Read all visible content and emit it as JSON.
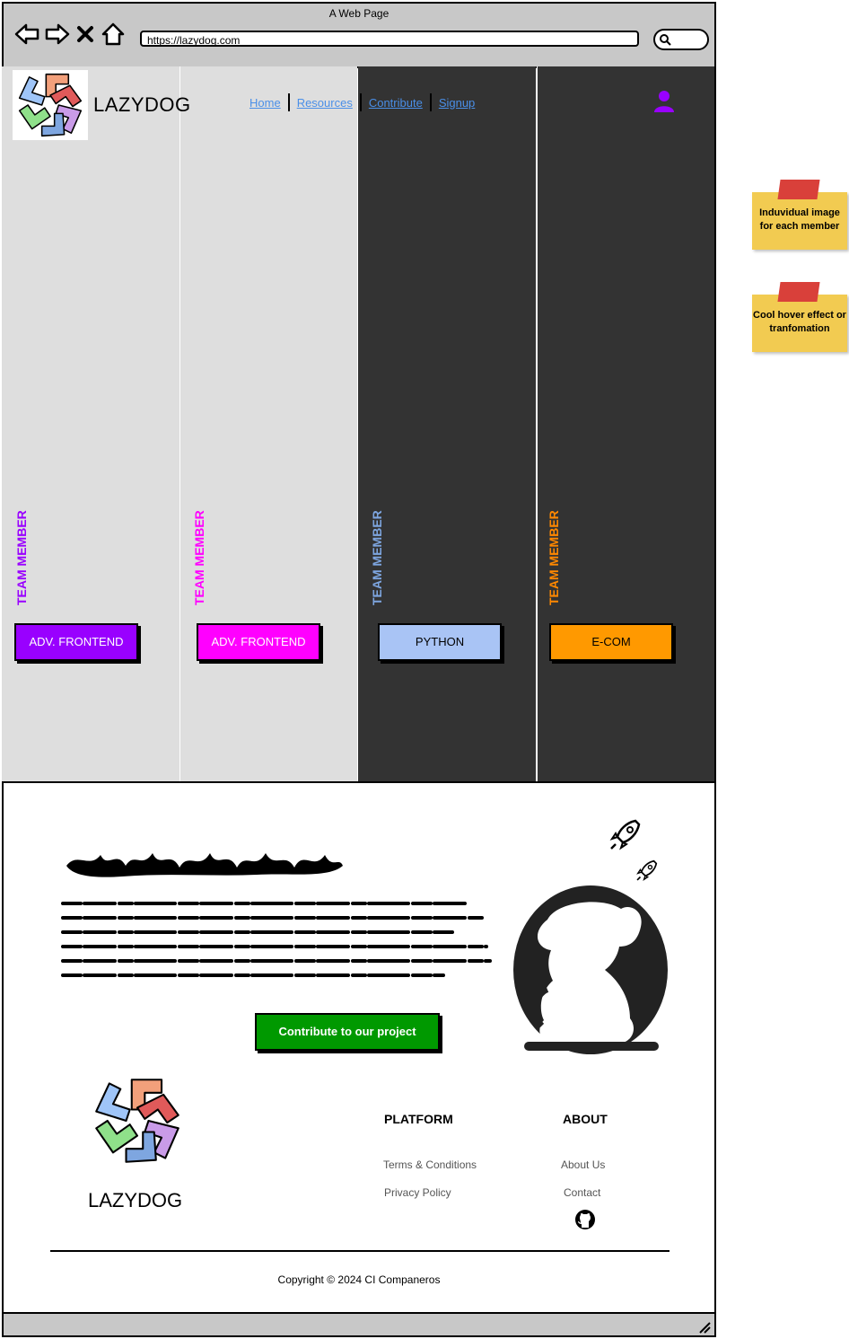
{
  "browser": {
    "window_title": "A Web Page",
    "url": "https://lazydog.com"
  },
  "header": {
    "brand": "LAZYDOG",
    "nav": [
      "Home",
      "Resources",
      "Contribute",
      "Signup"
    ]
  },
  "team": [
    {
      "label": "TEAM MEMBER",
      "label_color": "#9900ff",
      "role": "ADV. FRONTEND",
      "role_bg": "#9900ff",
      "role_fg": "#ffffff"
    },
    {
      "label": "TEAM MEMBER",
      "label_color": "#ff00ff",
      "role": "ADV. FRONTEND",
      "role_bg": "#ff00ff",
      "role_fg": "#ffffff"
    },
    {
      "label": "TEAM MEMBER",
      "label_color": "#7ea6e0",
      "role": "PYTHON",
      "role_bg": "#a9c4f5",
      "role_fg": "#000000"
    },
    {
      "label": "TEAM MEMBER",
      "label_color": "#ff8800",
      "role": "E-COM",
      "role_bg": "#ff9900",
      "role_fg": "#000000"
    }
  ],
  "hero": {
    "cta": "Contribute to our project"
  },
  "footer": {
    "brand": "LAZYDOG",
    "platform": {
      "heading": "PLATFORM",
      "links": [
        "Terms & Conditions",
        "Privacy Policy"
      ]
    },
    "about": {
      "heading": "ABOUT",
      "links": [
        "About Us",
        "Contact"
      ]
    },
    "copyright": "Copyright © 2024 CI Companeros"
  },
  "notes": [
    "Induvidual image for each member",
    "Cool hover effect or tranfomation"
  ],
  "icons": {
    "back": "back-arrow-icon",
    "forward": "forward-arrow-icon",
    "stop": "close-icon",
    "home": "home-icon",
    "search": "search-icon",
    "user": "user-icon",
    "github": "github-icon",
    "rocket": "rocket-icon"
  }
}
